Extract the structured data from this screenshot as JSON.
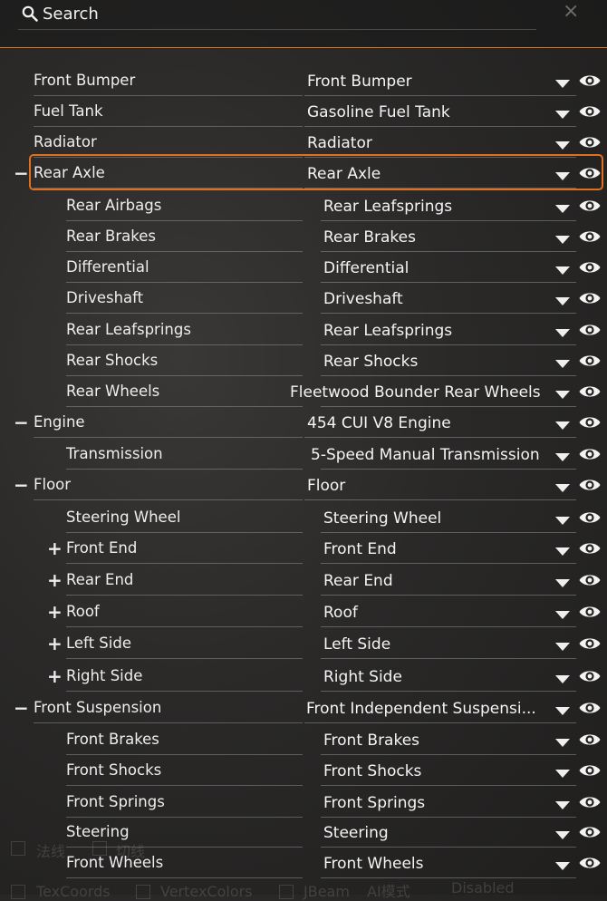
{
  "search": {
    "label": "Search",
    "close": "×"
  },
  "colors": {
    "accent": "#e0701f",
    "highlight_border": "#e0701f"
  },
  "selected_row": "Rear Axle",
  "rows": [
    {
      "toggle": "",
      "name": "Front Bumper",
      "value": "Front Bumper",
      "level": 0
    },
    {
      "toggle": "",
      "name": "Fuel Tank",
      "value": "Gasoline Fuel Tank",
      "level": 0
    },
    {
      "toggle": "",
      "name": "Radiator",
      "value": "Radiator",
      "level": 0
    },
    {
      "toggle": "−",
      "name": "Rear Axle",
      "value": "Rear Axle",
      "level": 0
    },
    {
      "toggle": "",
      "name": "Rear Airbags",
      "value": "Rear Leafsprings",
      "level": 1
    },
    {
      "toggle": "",
      "name": "Rear Brakes",
      "value": "Rear Brakes",
      "level": 1
    },
    {
      "toggle": "",
      "name": "Differential",
      "value": "Differential",
      "level": 1
    },
    {
      "toggle": "",
      "name": "Driveshaft",
      "value": "Driveshaft",
      "level": 1
    },
    {
      "toggle": "",
      "name": "Rear Leafsprings",
      "value": "Rear Leafsprings",
      "level": 1
    },
    {
      "toggle": "",
      "name": "Rear Shocks",
      "value": "Rear Shocks",
      "level": 1
    },
    {
      "toggle": "",
      "name": "Rear Wheels",
      "value": "Fleetwood Bounder Rear Wheels",
      "level": 1
    },
    {
      "toggle": "−",
      "name": "Engine",
      "value": "454 CUI V8 Engine",
      "level": 0
    },
    {
      "toggle": "",
      "name": "Transmission",
      "value": "5-Speed Manual Transmission",
      "level": 1
    },
    {
      "toggle": "−",
      "name": "Floor",
      "value": "Floor",
      "level": 0
    },
    {
      "toggle": "",
      "name": "Steering Wheel",
      "value": "Steering Wheel",
      "level": 1
    },
    {
      "toggle": "+",
      "name": "Front End",
      "value": "Front End",
      "level": 1
    },
    {
      "toggle": "+",
      "name": "Rear End",
      "value": "Rear End",
      "level": 1
    },
    {
      "toggle": "+",
      "name": "Roof",
      "value": "Roof",
      "level": 1
    },
    {
      "toggle": "+",
      "name": "Left Side",
      "value": "Left Side",
      "level": 1
    },
    {
      "toggle": "+",
      "name": "Right Side",
      "value": "Right Side",
      "level": 1
    },
    {
      "toggle": "−",
      "name": "Front Suspension",
      "value": "Front Independent Suspensi...",
      "level": 0
    },
    {
      "toggle": "",
      "name": "Front Brakes",
      "value": "Front Brakes",
      "level": 1
    },
    {
      "toggle": "",
      "name": "Front Shocks",
      "value": "Front Shocks",
      "level": 1
    },
    {
      "toggle": "",
      "name": "Front Springs",
      "value": "Front Springs",
      "level": 1
    },
    {
      "toggle": "",
      "name": "Steering",
      "value": "Steering",
      "level": 1
    },
    {
      "toggle": "",
      "name": "Front Wheels",
      "value": "Front Wheels",
      "level": 1
    }
  ],
  "background_options": {
    "normals": "法线",
    "tangents": "切线",
    "texcoords": "TexCoords",
    "vertexcolors": "VertexColors",
    "jbeam": "JBeam",
    "ai_mode_label": "AI模式",
    "ai_mode_value": "Disabled"
  }
}
